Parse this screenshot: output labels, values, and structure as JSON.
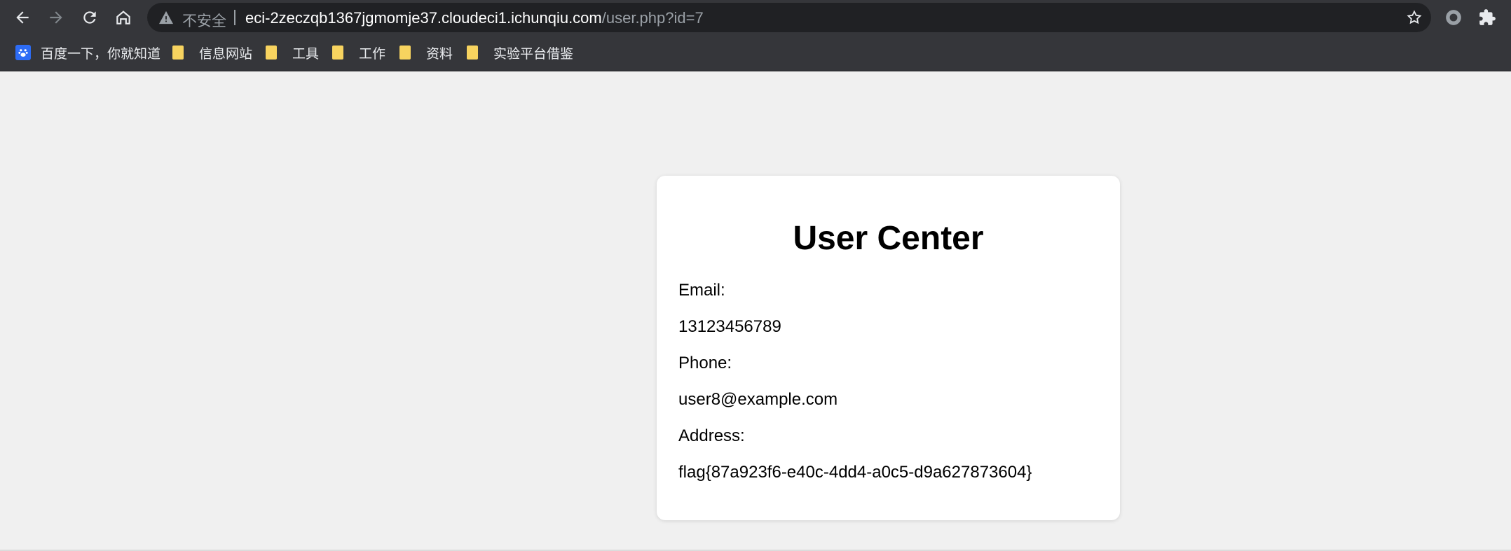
{
  "browser": {
    "security_label": "不安全",
    "url_host": "eci-2zeczqb1367jgmomje37.cloudeci1.ichunqiu.com",
    "url_path": "/user.php?id=7"
  },
  "bookmarks": [
    {
      "label": "百度一下，你就知道",
      "icon": "baidu-paw-icon"
    },
    {
      "label": "信息网站",
      "icon": "folder-icon"
    },
    {
      "label": "工具",
      "icon": "folder-icon"
    },
    {
      "label": "工作",
      "icon": "folder-icon"
    },
    {
      "label": "资料",
      "icon": "folder-icon"
    },
    {
      "label": "实验平台借鉴",
      "icon": "folder-icon"
    }
  ],
  "card": {
    "title": "User Center",
    "email_label": "Email:",
    "email_value": "13123456789",
    "phone_label": "Phone:",
    "phone_value": "user8@example.com",
    "address_label": "Address:",
    "address_value": "flag{87a923f6-e40c-4dd4-a0c5-d9a627873604}"
  },
  "colors": {
    "toolbar_bg": "#35363a",
    "omnibox_bg": "#202124",
    "page_bg": "#f0f0f0",
    "folder": "#f7d35f"
  }
}
